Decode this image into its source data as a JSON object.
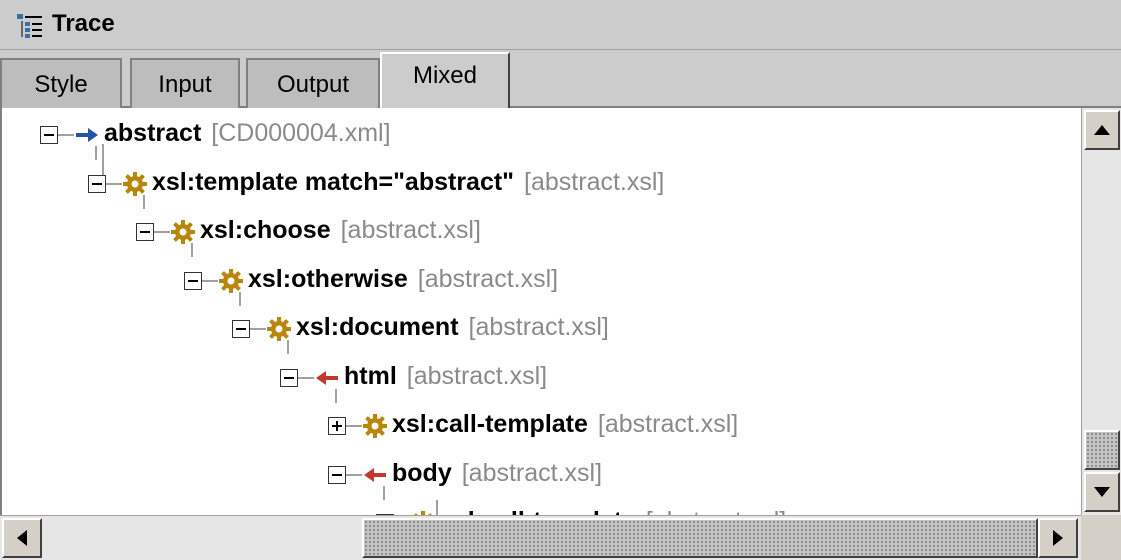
{
  "window": {
    "title": "Trace",
    "icon": "trace-tree-icon"
  },
  "tabs": [
    {
      "label": "Style",
      "active": false
    },
    {
      "label": "Input",
      "active": false
    },
    {
      "label": "Output",
      "active": false
    },
    {
      "label": "Mixed",
      "active": true
    }
  ],
  "tree": {
    "nodes": [
      {
        "name": "abstract",
        "file": "[CD000004.xml]",
        "icon": "blue-arrow-icon",
        "expanded": true
      },
      {
        "name": "xsl:template match=\"abstract\"",
        "file": "[abstract.xsl]",
        "icon": "gear-icon",
        "expanded": true
      },
      {
        "name": "xsl:choose",
        "file": "[abstract.xsl]",
        "icon": "gear-icon",
        "expanded": true
      },
      {
        "name": "xsl:otherwise",
        "file": "[abstract.xsl]",
        "icon": "gear-icon",
        "expanded": true
      },
      {
        "name": "xsl:document",
        "file": "[abstract.xsl]",
        "icon": "gear-icon",
        "expanded": true
      },
      {
        "name": "html",
        "file": "[abstract.xsl]",
        "icon": "red-arrow-icon",
        "expanded": true
      },
      {
        "name": "xsl:call-template",
        "file": "[abstract.xsl]",
        "icon": "gear-icon",
        "expanded": false
      },
      {
        "name": "body",
        "file": "[abstract.xsl]",
        "icon": "red-arrow-icon",
        "expanded": true
      },
      {
        "name": "xsl:call-template",
        "file": "[abstract.xsl]",
        "icon": "gear-icon",
        "expanded": true
      }
    ]
  },
  "colors": {
    "gear": "#b8860b",
    "blue_arrow": "#2255aa",
    "red_arrow": "#c0392b",
    "file_text": "#8a8a8a"
  },
  "scrollbars": {
    "vertical_position": 0.8,
    "horizontal_position": 0.52
  }
}
